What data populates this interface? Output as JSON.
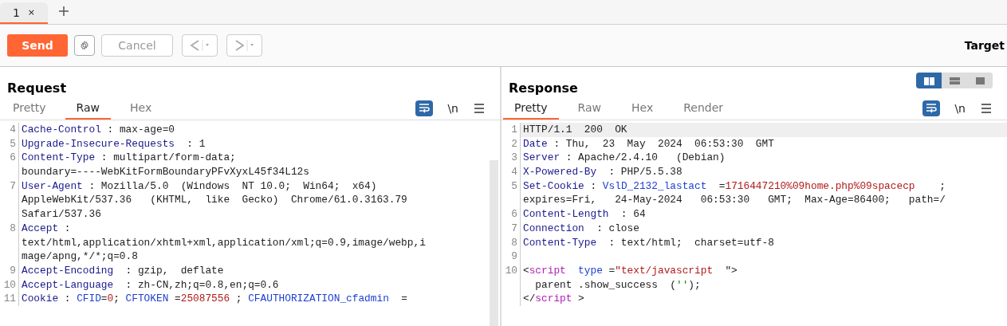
{
  "tabs": [
    {
      "label": "1",
      "close": "×",
      "selected": true
    }
  ],
  "toolbar": {
    "send": "Send",
    "cancel": "Cancel",
    "target": "Target"
  },
  "view_modes": [
    {
      "selected": true
    },
    {
      "selected": false
    },
    {
      "selected": false
    }
  ],
  "request": {
    "title": "Request",
    "tabs": [
      {
        "label": "Pretty",
        "selected": false
      },
      {
        "label": "Raw",
        "selected": true
      },
      {
        "label": "Hex",
        "selected": false
      }
    ],
    "newline": "\\n",
    "rows": [
      {
        "num": "4",
        "current": false,
        "parts": [
          {
            "kind": "key",
            "text": "Cache-Control"
          },
          {
            "kind": "plain",
            "text": " : max-age=0"
          }
        ]
      },
      {
        "num": "5",
        "current": false,
        "parts": [
          {
            "kind": "key",
            "text": "Upgrade-Insecure-Requests"
          },
          {
            "kind": "plain",
            "text": "  : 1"
          }
        ]
      },
      {
        "num": "6",
        "current": false,
        "parts": [
          {
            "kind": "key",
            "text": "Content-Type"
          },
          {
            "kind": "plain",
            "text": " : multipart/form-data;"
          }
        ]
      },
      {
        "current": false,
        "parts": [
          {
            "kind": "plain",
            "text": "boundary=----WebKitFormBoundaryPFvXyxL45f34L12s"
          }
        ]
      },
      {
        "num": "7",
        "current": false,
        "parts": [
          {
            "kind": "key",
            "text": "User-Agent"
          },
          {
            "kind": "plain",
            "text": " : Mozilla/5.0  (Windows  NT 10.0;  Win64;  x64)"
          }
        ]
      },
      {
        "current": false,
        "parts": [
          {
            "kind": "plain",
            "text": "AppleWebKit/537.36   (KHTML,  like  Gecko)  Chrome/61.0.3163.79"
          }
        ]
      },
      {
        "current": false,
        "parts": [
          {
            "kind": "plain",
            "text": "Safari/537.36"
          }
        ]
      },
      {
        "num": "8",
        "current": false,
        "parts": [
          {
            "kind": "key",
            "text": "Accept"
          },
          {
            "kind": "plain",
            "text": " :"
          }
        ]
      },
      {
        "current": false,
        "parts": [
          {
            "kind": "plain",
            "text": "text/html,application/xhtml+xml,application/xml;q=0.9,image/webp,i"
          }
        ]
      },
      {
        "current": false,
        "parts": [
          {
            "kind": "plain",
            "text": "mage/apng,*/*;q=0.8"
          }
        ]
      },
      {
        "num": "9",
        "current": false,
        "parts": [
          {
            "kind": "key",
            "text": "Accept-Encoding"
          },
          {
            "kind": "plain",
            "text": "  : gzip,  deflate"
          }
        ]
      },
      {
        "num": "10",
        "current": false,
        "parts": [
          {
            "kind": "key",
            "text": "Accept-Language"
          },
          {
            "kind": "plain",
            "text": "  : zh-CN,zh;q=0.8,en;q=0.6"
          }
        ]
      },
      {
        "num": "11",
        "current": false,
        "parts": [
          {
            "kind": "key",
            "text": "Cookie"
          },
          {
            "kind": "plain",
            "text": " : "
          },
          {
            "kind": "name",
            "text": "CFID"
          },
          {
            "kind": "plain",
            "text": "="
          },
          {
            "kind": "value",
            "text": "0"
          },
          {
            "kind": "plain",
            "text": "; "
          },
          {
            "kind": "name",
            "text": "CFTOKEN"
          },
          {
            "kind": "plain",
            "text": " ="
          },
          {
            "kind": "value",
            "text": "25087556"
          },
          {
            "kind": "plain",
            "text": " ; "
          },
          {
            "kind": "name",
            "text": "CFAUTHORIZATION_cfadmin"
          },
          {
            "kind": "plain",
            "text": "  ="
          }
        ]
      }
    ]
  },
  "response": {
    "title": "Response",
    "tabs": [
      {
        "label": "Pretty",
        "selected": true
      },
      {
        "label": "Raw",
        "selected": false
      },
      {
        "label": "Hex",
        "selected": false
      },
      {
        "label": "Render",
        "selected": false
      }
    ],
    "newline": "\\n",
    "rows": [
      {
        "num": "1",
        "current": true,
        "parts": [
          {
            "kind": "plain",
            "text": "HTTP/1.1  200  OK"
          }
        ]
      },
      {
        "num": "2",
        "current": false,
        "parts": [
          {
            "kind": "key",
            "text": "Date"
          },
          {
            "kind": "plain",
            "text": " : Thu,  23  May  2024  06:53:30  GMT"
          }
        ]
      },
      {
        "num": "3",
        "current": false,
        "parts": [
          {
            "kind": "key",
            "text": "Server"
          },
          {
            "kind": "plain",
            "text": " : Apache/2.4.10   (Debian)"
          }
        ]
      },
      {
        "num": "4",
        "current": false,
        "parts": [
          {
            "kind": "key",
            "text": "X-Powered-By"
          },
          {
            "kind": "plain",
            "text": "  : PHP/5.5.38"
          }
        ]
      },
      {
        "num": "5",
        "current": false,
        "parts": [
          {
            "kind": "key",
            "text": "Set-Cookie"
          },
          {
            "kind": "plain",
            "text": " : "
          },
          {
            "kind": "name",
            "text": "VslD_2132_lastact"
          },
          {
            "kind": "plain",
            "text": "  ="
          },
          {
            "kind": "value",
            "text": "1716447210%09home.php%09spacecp"
          },
          {
            "kind": "plain",
            "text": "    ;"
          }
        ]
      },
      {
        "current": false,
        "parts": [
          {
            "kind": "plain",
            "text": "expires=Fri,   24-May-2024   06:53:30   GMT;  Max-Age=86400;   path=/"
          }
        ]
      },
      {
        "num": "6",
        "current": false,
        "parts": [
          {
            "kind": "key",
            "text": "Content-Length"
          },
          {
            "kind": "plain",
            "text": "  : 64"
          }
        ]
      },
      {
        "num": "7",
        "current": false,
        "parts": [
          {
            "kind": "key",
            "text": "Connection"
          },
          {
            "kind": "plain",
            "text": "  : close"
          }
        ]
      },
      {
        "num": "8",
        "current": false,
        "parts": [
          {
            "kind": "key",
            "text": "Content-Type"
          },
          {
            "kind": "plain",
            "text": "  : text/html;  charset=utf-8"
          }
        ]
      },
      {
        "num": "9",
        "current": false,
        "parts": []
      },
      {
        "num": "10",
        "current": false,
        "parts": [
          {
            "kind": "punct",
            "text": "<"
          },
          {
            "kind": "tag",
            "text": "script"
          },
          {
            "kind": "name",
            "text": "  type"
          },
          {
            "kind": "plain",
            "text": " ="
          },
          {
            "kind": "value",
            "text": "\"text/javascript"
          },
          {
            "kind": "plain",
            "text": "  \">"
          }
        ]
      },
      {
        "current": false,
        "parts": [
          {
            "kind": "plain",
            "text": "  parent .show_success  ("
          },
          {
            "kind": "str",
            "text": "''"
          },
          {
            "kind": "plain",
            "text": ");"
          }
        ]
      },
      {
        "current": false,
        "parts": [
          {
            "kind": "plain",
            "text": "</"
          },
          {
            "kind": "tag",
            "text": "script"
          },
          {
            "kind": "plain",
            "text": " >"
          }
        ]
      }
    ]
  }
}
